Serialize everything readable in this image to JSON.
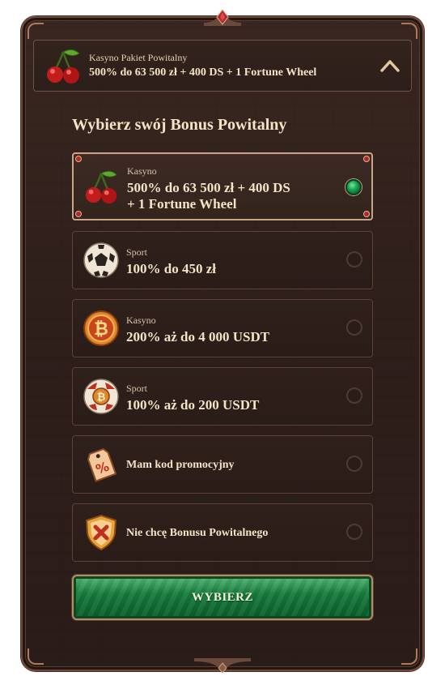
{
  "header": {
    "small": "Kasyno Pakiet Powitalny",
    "main": "500% do 63 500 zł + 400 DS + 1 Fortune Wheel"
  },
  "title": "Wybierz swój Bonus Powitalny",
  "options": [
    {
      "small": "Kasyno",
      "main_line1": "500% do 63 500 zł + 400 DS",
      "main_line2": "+ 1 Fortune Wheel",
      "icon": "cherry-icon",
      "selected": true
    },
    {
      "small": "Sport",
      "main": "100% do 450 zł",
      "icon": "soccer-ball-icon",
      "selected": false
    },
    {
      "small": "Kasyno",
      "main": "200% aż do 4 000 USDT",
      "icon": "bitcoin-coin-icon",
      "selected": false
    },
    {
      "small": "Sport",
      "main": "100% aż do 200 USDT",
      "icon": "bitcoin-ball-icon",
      "selected": false
    },
    {
      "label": "Mam kod promocyjny",
      "icon": "promo-tag-icon",
      "selected": false
    },
    {
      "label": "Nie chcę Bonusu Powitalnego",
      "icon": "shield-x-icon",
      "selected": false
    }
  ],
  "button": {
    "label": "WYBIERZ"
  },
  "colors": {
    "panel_bg": "#2e1f1b",
    "text": "#f3e4c6",
    "border": "#5c4237",
    "selected_border": "#c9a584",
    "green": "#157a3a"
  }
}
